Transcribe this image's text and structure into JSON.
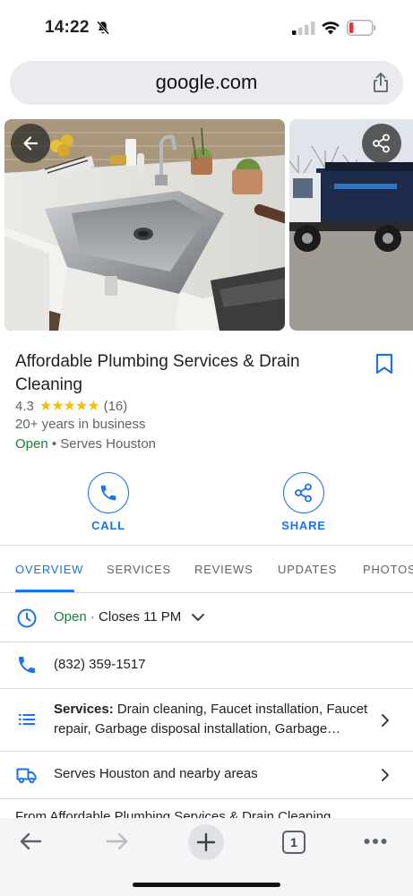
{
  "status_bar": {
    "time": "14:22"
  },
  "browser": {
    "url": "google.com"
  },
  "business": {
    "name": "Affordable Plumbing Services & Drain Cleaning",
    "rating": "4.3",
    "stars": "★★★★★",
    "review_count": "(16)",
    "years": "20+ years in business",
    "open_status": "Open",
    "service_area": "• Serves Houston"
  },
  "actions": {
    "call": "CALL",
    "share": "SHARE"
  },
  "tabs": [
    "OVERVIEW",
    "SERVICES",
    "REVIEWS",
    "UPDATES",
    "PHOTOS"
  ],
  "details": {
    "hours_open": "Open",
    "hours_sep": "·",
    "hours_closes": "Closes 11 PM",
    "phone": "(832) 359-1517",
    "services_label": "Services:",
    "services_text": "Drain cleaning, Faucet installation, Faucet repair, Garbage disposal installation, Garbage…",
    "service_area": "Serves Houston and nearby areas",
    "peek_text": "From Affordable Plumbing Services & Drain Cleaning"
  },
  "bottom_nav": {
    "tab_count": "1"
  },
  "icons": {
    "bell": "bell-slash-icon",
    "back": "arrow-left-icon",
    "share": "share-icon",
    "bookmark": "bookmark-icon",
    "phone": "phone-icon",
    "clock": "clock-icon",
    "list": "list-icon",
    "truck": "truck-icon"
  },
  "colors": {
    "accent": "#1a73e8",
    "open": "#188038",
    "star": "#fbbc04"
  }
}
